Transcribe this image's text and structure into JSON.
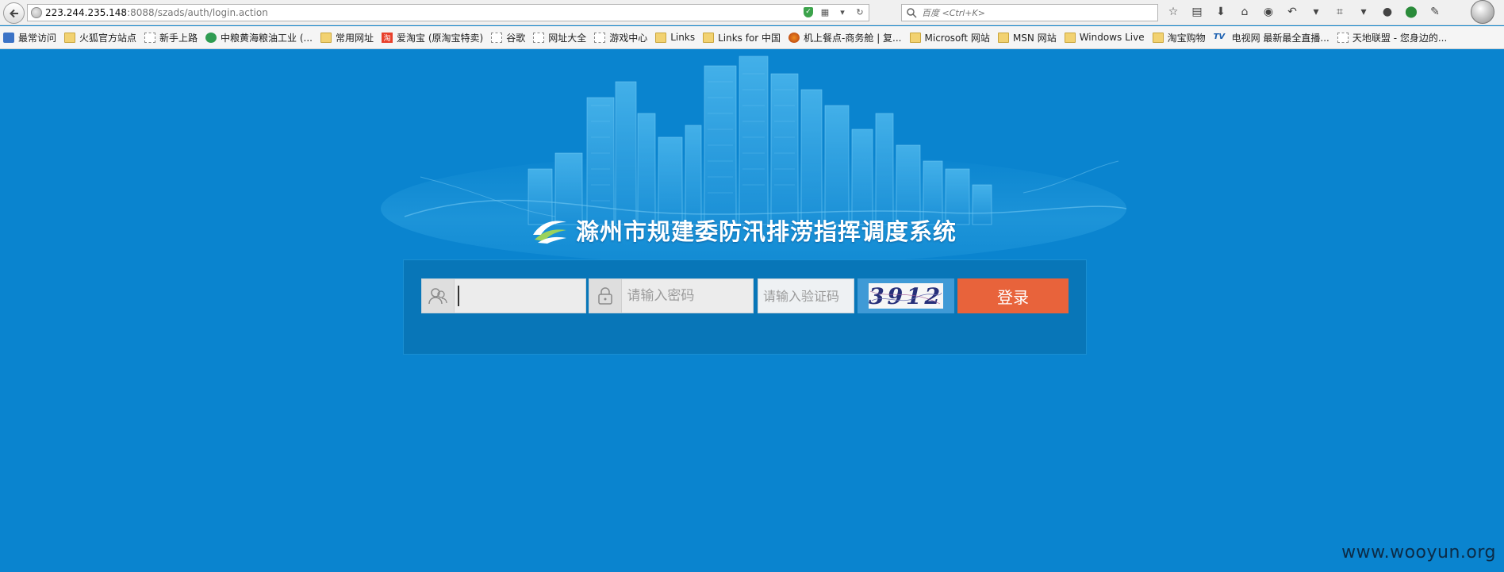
{
  "browser": {
    "url_host": "223.244.235.148",
    "url_rest": ":8088/szads/auth/login.action",
    "search_placeholder": "百度 <Ctrl+K>",
    "bookmarks": [
      {
        "label": "最常访问",
        "icon": "blue"
      },
      {
        "label": "火狐官方站点",
        "icon": "folder"
      },
      {
        "label": "新手上路",
        "icon": "page"
      },
      {
        "label": "中粮黄海粮油工业 (...",
        "icon": "green"
      },
      {
        "label": "常用网址",
        "icon": "folder"
      },
      {
        "label": "爱淘宝 (原淘宝特卖)",
        "icon": "taobao"
      },
      {
        "label": "谷歌",
        "icon": "page"
      },
      {
        "label": "网址大全",
        "icon": "page"
      },
      {
        "label": "游戏中心",
        "icon": "page"
      },
      {
        "label": "Links",
        "icon": "folder"
      },
      {
        "label": "Links for 中国",
        "icon": "folder"
      },
      {
        "label": "机上餐点-商务舱 | 复...",
        "icon": "fox"
      },
      {
        "label": "Microsoft 网站",
        "icon": "folder"
      },
      {
        "label": "MSN 网站",
        "icon": "folder"
      },
      {
        "label": "Windows Live",
        "icon": "folder"
      },
      {
        "label": "淘宝购物",
        "icon": "folder"
      },
      {
        "label": "电视网 最新最全直播...",
        "icon": "tv"
      },
      {
        "label": "天地联盟 - 您身边的...",
        "icon": "page"
      }
    ],
    "taobao_glyph": "淘",
    "tv_glyph": "TV"
  },
  "page": {
    "title": "滁州市规建委防汛排涝指挥调度系统",
    "background_color": "#0a84cf",
    "login": {
      "username_value": "",
      "password_placeholder": "请输入密码",
      "captcha_placeholder": "请输入验证码",
      "captcha_text": "3912",
      "submit_label": "登录",
      "button_color": "#e8633b"
    }
  },
  "watermark": "www.wooyun.org"
}
